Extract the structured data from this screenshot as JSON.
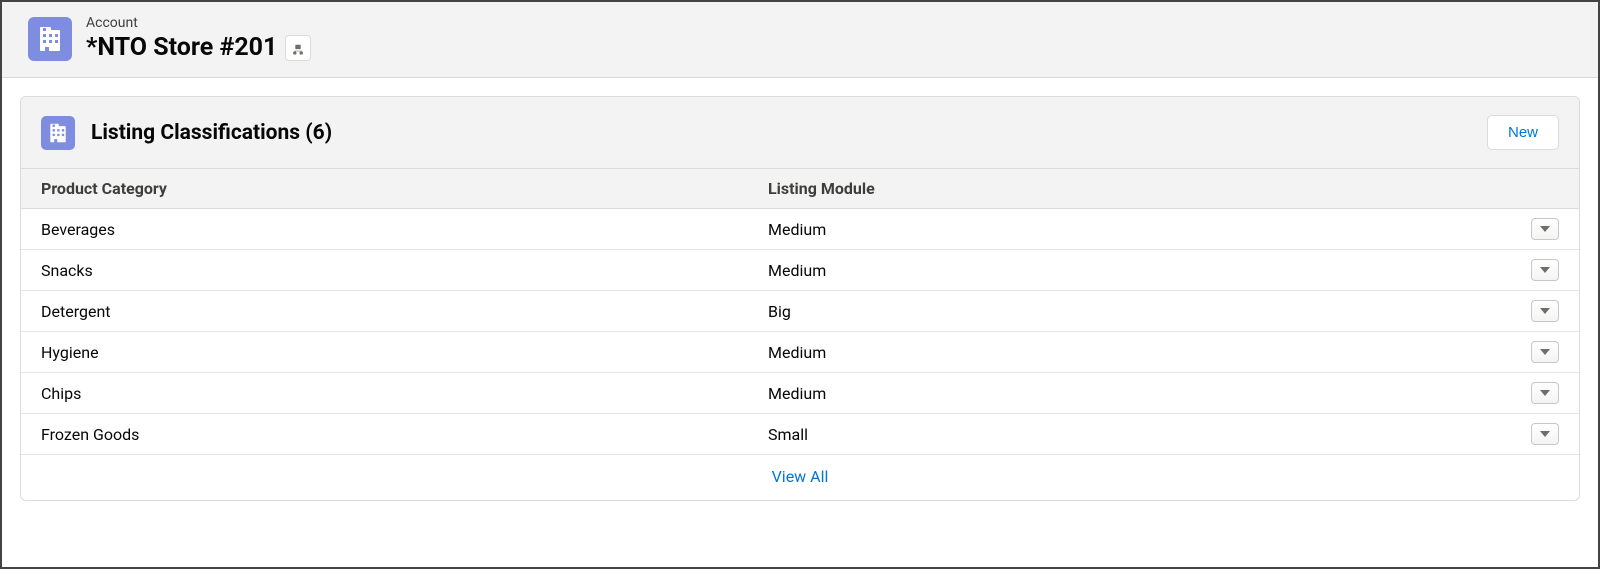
{
  "record": {
    "object_label": "Account",
    "title": "*NTO Store #201"
  },
  "related": {
    "title": "Listing Classifications (6)",
    "new_button": "New",
    "view_all": "View All",
    "columns": {
      "product_category": "Product Category",
      "listing_module": "Listing Module"
    },
    "rows": [
      {
        "category": "Beverages",
        "module": "Medium"
      },
      {
        "category": "Snacks",
        "module": "Medium"
      },
      {
        "category": "Detergent",
        "module": "Big"
      },
      {
        "category": "Hygiene",
        "module": "Medium"
      },
      {
        "category": "Chips",
        "module": "Medium"
      },
      {
        "category": "Frozen Goods",
        "module": "Small"
      }
    ]
  }
}
